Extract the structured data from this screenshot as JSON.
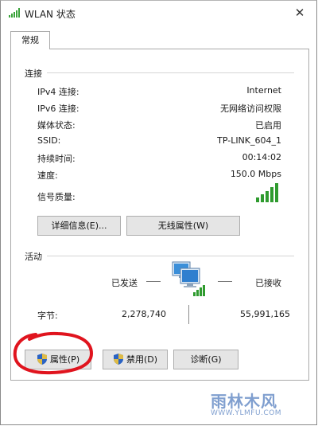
{
  "window": {
    "title": "WLAN 状态",
    "close_glyph": "✕"
  },
  "tab": {
    "label": "常规"
  },
  "connection": {
    "heading": "连接",
    "rows": [
      {
        "label": "IPv4 连接:",
        "value": "Internet"
      },
      {
        "label": "IPv6 连接:",
        "value": "无网络访问权限"
      },
      {
        "label": "媒体状态:",
        "value": "已启用"
      },
      {
        "label": "SSID:",
        "value": "TP-LINK_604_1"
      },
      {
        "label": "持续时间:",
        "value": "00:14:02"
      },
      {
        "label": "速度:",
        "value": "150.0 Mbps"
      }
    ],
    "signal_label": "信号质量:",
    "signal_bars": 5,
    "details_button": "详细信息(E)...",
    "wireless_button": "无线属性(W)"
  },
  "activity": {
    "heading": "活动",
    "sent_label": "已发送",
    "received_label": "已接收",
    "bytes_label": "字节:",
    "bytes_sent": "2,278,740",
    "bytes_received": "55,991,165"
  },
  "buttons": {
    "properties": "属性(P)",
    "disable": "禁用(D)",
    "diagnose": "诊断(G)"
  },
  "icons": {
    "title": "wifi-signal-icon",
    "signal": "signal-strength-icon",
    "activity": "network-computers-icon",
    "shield": "uac-shield-icon"
  },
  "colors": {
    "accent_green": "#3aa33a",
    "annotation_red": "#e0141e",
    "watermark_blue": "#6a8fc7"
  },
  "watermark": {
    "text": "雨林木风",
    "url": "WWW.YLMFU.COM"
  }
}
